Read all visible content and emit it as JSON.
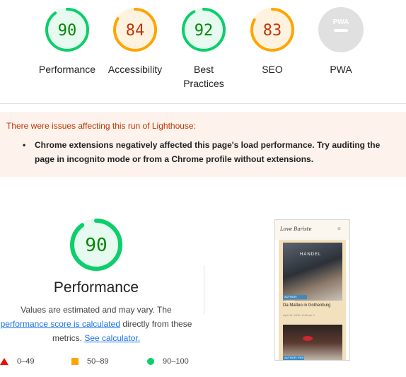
{
  "gauges": [
    {
      "score": "90",
      "label": "Performance",
      "fraction": 0.9,
      "status": "pass"
    },
    {
      "score": "84",
      "label": "Accessibility",
      "fraction": 0.84,
      "status": "average"
    },
    {
      "score": "92",
      "label": "Best Practices",
      "fraction": 0.92,
      "status": "pass"
    },
    {
      "score": "83",
      "label": "SEO",
      "fraction": 0.83,
      "status": "average"
    },
    {
      "score": "PWA",
      "label": "PWA",
      "fraction": 0,
      "status": "na"
    }
  ],
  "colors": {
    "pass": "#0cce6b",
    "pass_bg": "#e6faf0",
    "pass_text": "#008800",
    "average": "#ffa400",
    "average_bg": "#fff3e0",
    "average_text": "#c33300",
    "fail": "#eb0f00",
    "na": "#e0e0e0",
    "na_text": "#9e9e9e"
  },
  "warning": {
    "title": "There were issues affecting this run of Lighthouse:",
    "item": "Chrome extensions negatively affected this page's load performance. Try auditing the page in incognito mode or from a Chrome profile without extensions."
  },
  "performance": {
    "score": "90",
    "fraction": 0.9,
    "title": "Performance",
    "desc_prefix": "Values are estimated and may vary. The",
    "desc_link": "performance score is calculated",
    "desc_middle": "directly from these metrics.",
    "calc_link": "See calculator."
  },
  "legend": {
    "fail": "0–49",
    "average": "50–89",
    "pass": "90–100"
  },
  "thumbnail": {
    "logo": "Love Bariste",
    "menu_icon": "≡",
    "shop_sign": "HANDEL",
    "tag1": "AUTHOR: HENRIK",
    "caption": "Da Matteo in Gothenburg",
    "meta": "April 14, 2020, 8:48 am  0",
    "tag2": "AUTHOR: PER"
  }
}
